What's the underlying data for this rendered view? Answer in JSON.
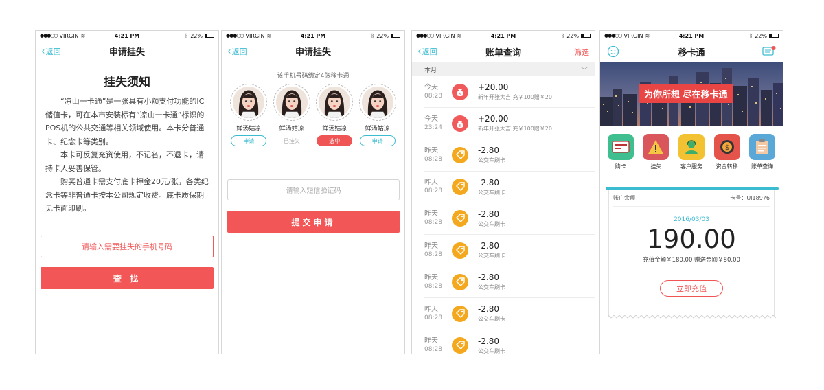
{
  "status": {
    "carrier": "VIRGIN",
    "time": "4:21 PM",
    "battery": "22%"
  },
  "colors": {
    "accent": "#3bbcd0",
    "brand_red": "#f25656",
    "orange": "#f3a81d"
  },
  "screen1": {
    "back": "返回",
    "title": "申请挂失",
    "heading": "挂失须知",
    "para1": "“凉山一卡通”是一张具有小额支付功能的IC储值卡，可在本市安装标有“凉山一卡通”标识的POS机的公共交通等相关领域使用。本卡分普通卡、纪念卡等类别。",
    "para2": "本卡可反复充资使用，不记名，不退卡，请持卡人妥善保管。",
    "para3": "购买普通卡需支付底卡押金20元/张，各类纪念卡等非普通卡按本公司规定收费。底卡质保期见卡面印刷。",
    "phone_placeholder": "请输入需要挂失的手机号码",
    "search_btn": "查 找"
  },
  "screen2": {
    "back": "返回",
    "title": "申请挂失",
    "hint": "该手机号码绑定4张移卡通",
    "cards": [
      {
        "name": "鲜汤姑凉",
        "status": "申请",
        "kind": "apply"
      },
      {
        "name": "鲜汤姑凉",
        "status": "已挂失",
        "kind": "lost"
      },
      {
        "name": "鲜汤姑凉",
        "status": "选中",
        "kind": "sel"
      },
      {
        "name": "鲜汤姑凉",
        "status": "申请",
        "kind": "apply"
      }
    ],
    "sms_placeholder": "请输入短信验证码",
    "submit_btn": "提交申请"
  },
  "screen3": {
    "back": "返回",
    "title": "账单查询",
    "filter": "筛选",
    "month": "本月",
    "transactions": [
      {
        "day": "今天",
        "time": "08:28",
        "amount": "+20.00",
        "desc": "新年开张大吉 充￥100赠￥20",
        "type": "topup"
      },
      {
        "day": "今天",
        "time": "23:24",
        "amount": "+20.00",
        "desc": "新年开张大吉 充￥100赠￥20",
        "type": "topup"
      },
      {
        "day": "昨天",
        "time": "08:28",
        "amount": "-2.80",
        "desc": "公交车刷卡",
        "type": "spend"
      },
      {
        "day": "昨天",
        "time": "08:28",
        "amount": "-2.80",
        "desc": "公交车刷卡",
        "type": "spend"
      },
      {
        "day": "昨天",
        "time": "08:28",
        "amount": "-2.80",
        "desc": "公交车刷卡",
        "type": "spend"
      },
      {
        "day": "昨天",
        "time": "08:28",
        "amount": "-2.80",
        "desc": "公交车刷卡",
        "type": "spend"
      },
      {
        "day": "昨天",
        "time": "08:28",
        "amount": "-2.80",
        "desc": "公交车刷卡",
        "type": "spend"
      },
      {
        "day": "昨天",
        "time": "08:28",
        "amount": "-2.80",
        "desc": "公交车刷卡",
        "type": "spend"
      },
      {
        "day": "昨天",
        "time": "08:28",
        "amount": "-2.80",
        "desc": "公交车刷卡",
        "type": "spend"
      }
    ]
  },
  "screen4": {
    "title": "移卡通",
    "banner": "为你所想 尽在移卡通",
    "grid": [
      {
        "label": "购卡",
        "icon": "card-icon",
        "color": "#3fbf8f"
      },
      {
        "label": "挂失",
        "icon": "warning-icon",
        "color": "#d9575c"
      },
      {
        "label": "客户服务",
        "icon": "service-icon",
        "color": "#f2c233"
      },
      {
        "label": "资金转移",
        "icon": "coin-icon",
        "color": "#e4544b"
      },
      {
        "label": "账单查询",
        "icon": "clipboard-icon",
        "color": "#5aa8d8"
      }
    ],
    "account": {
      "label": "账户余额",
      "card_no": "卡号：UI18976",
      "date": "2016/03/03",
      "balance": "190.00",
      "breakdown": "充值金额￥180.00   赠送金额￥80.00",
      "recharge_btn": "立即充值"
    }
  }
}
